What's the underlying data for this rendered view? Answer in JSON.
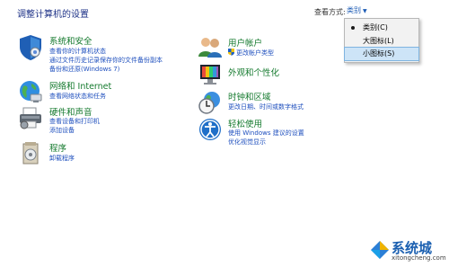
{
  "header": {
    "title": "调整计算机的设置",
    "view_by_label": "查看方式:",
    "view_by_value": "类别"
  },
  "dropdown": {
    "items": [
      {
        "label": "类别(C)"
      },
      {
        "label": "大图标(L)"
      },
      {
        "label": "小图标(S)"
      }
    ]
  },
  "left_column": [
    {
      "title": "系统和安全",
      "links": [
        "查看你的计算机状态",
        "通过文件历史记录保存你的文件备份副本",
        "备份和还原(Windows 7)"
      ]
    },
    {
      "title": "网络和 Internet",
      "links": [
        "查看网络状态和任务"
      ]
    },
    {
      "title": "硬件和声音",
      "links": [
        "查看设备和打印机",
        "添加设备"
      ]
    },
    {
      "title": "程序",
      "links": [
        "卸载程序"
      ]
    }
  ],
  "right_column": [
    {
      "title": "用户帐户",
      "links": [
        "更改帐户类型"
      ]
    },
    {
      "title": "外观和个性化",
      "links": []
    },
    {
      "title": "时钟和区域",
      "links": [
        "更改日期、时间或数字格式"
      ]
    },
    {
      "title": "轻松使用",
      "links": [
        "使用 Windows 建议的设置",
        "优化视觉显示"
      ]
    }
  ],
  "watermark": {
    "text": "系统城",
    "url": "xitongcheng.com"
  },
  "colors": {
    "title_blue": "#1e3287",
    "category_green": "#157a2e",
    "link_blue": "#1e4fbe",
    "selection": "#cde4f7"
  }
}
